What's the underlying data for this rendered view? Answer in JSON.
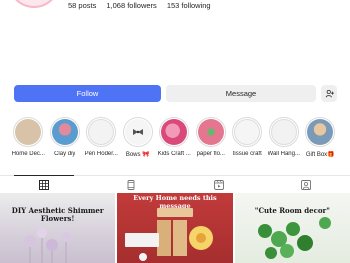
{
  "profile": {
    "stats": {
      "posts": "58 posts",
      "followers": "1,068 followers",
      "following": "153 following"
    }
  },
  "actions": {
    "follow_label": "Follow",
    "message_label": "Message",
    "add_user_icon": "add-user-icon",
    "accent_color": "#4e73f5"
  },
  "highlights": [
    {
      "label": "Home Dec...",
      "color": "#d8c3a8"
    },
    {
      "label": "Clay diy",
      "color": "#5a9bd0"
    },
    {
      "label": "Pen Hoder...",
      "color": "#f3f3f3"
    },
    {
      "label": "Bows 🎀",
      "color": "#f5f5f5"
    },
    {
      "label": "Kids Craft ...",
      "color": "#d94a7a"
    },
    {
      "label": "paper flo...",
      "color": "#e5768f"
    },
    {
      "label": "tissue craft",
      "color": "#f5f5f5"
    },
    {
      "label": "Wall Hang...",
      "color": "#f2f2f2"
    },
    {
      "label": "Gift Box🎁",
      "color": "#7a9bb8"
    }
  ],
  "tabs": [
    {
      "icon": "grid-icon"
    },
    {
      "icon": "reels-icon"
    },
    {
      "icon": "video-icon"
    },
    {
      "icon": "tagged-icon"
    }
  ],
  "posts": [
    {
      "caption": "DIY Aesthetic Shimmer Flowers!"
    },
    {
      "caption": "Every Home needs this message"
    },
    {
      "caption": "\"Cute Room decor\""
    }
  ]
}
